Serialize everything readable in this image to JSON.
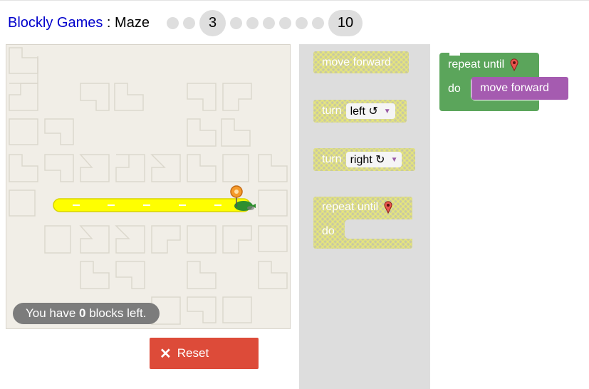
{
  "header": {
    "app_link": "Blockly Games",
    "separator": " : ",
    "page_name": "Maze",
    "current_level": "3",
    "last_level": "10"
  },
  "maze": {
    "blocks_left_prefix": "You have ",
    "blocks_left_count": "0",
    "blocks_left_suffix": " blocks left.",
    "path_color": "#ffff00",
    "marker_icon": "map-pin-icon",
    "player_icon": "pegman-icon"
  },
  "reset": {
    "icon": "close-icon",
    "label": "Reset"
  },
  "toolbox": {
    "move_forward": "move forward",
    "turn_label": "turn",
    "turn_left_value": "left ↺",
    "turn_right_value": "right ↻",
    "repeat_until": "repeat until",
    "do_label": "do"
  },
  "workspace": {
    "repeat_until": "repeat until",
    "do_label": "do",
    "move_forward": "move forward"
  },
  "colors": {
    "loop_block": "#5ba55b",
    "movement_block": "#a55bb0",
    "reset_button": "#dd4b39",
    "link": "#0000cc"
  }
}
